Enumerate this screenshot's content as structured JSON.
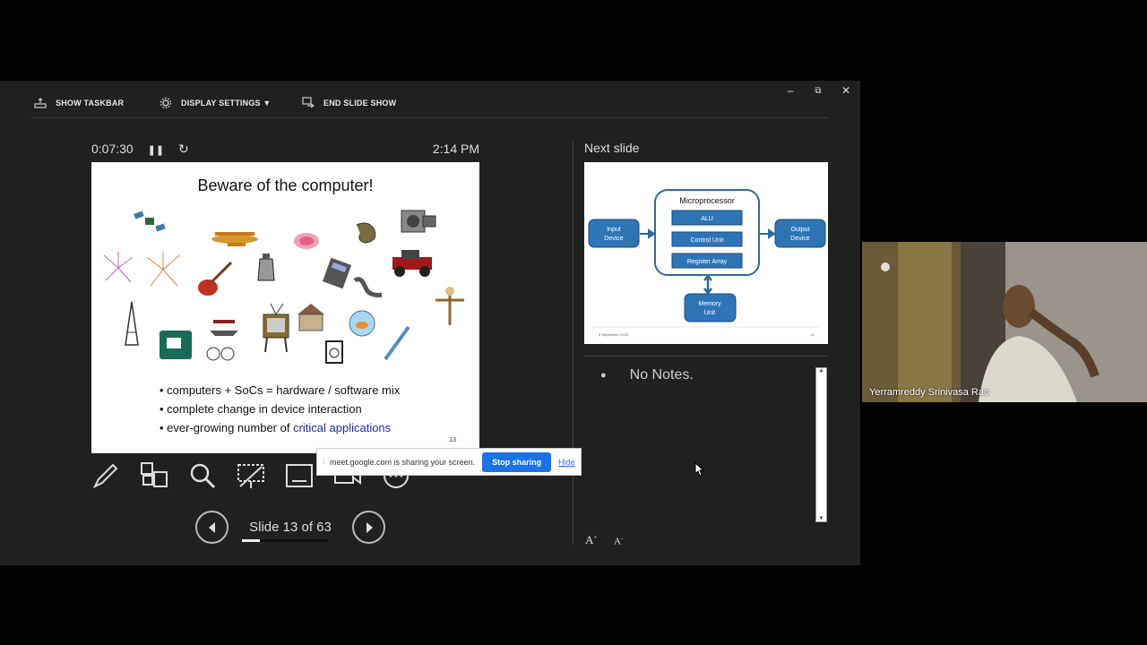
{
  "toolbar": {
    "show_taskbar": "SHOW TASKBAR",
    "display_settings": "DISPLAY SETTINGS ▼",
    "end_slide_show": "END SLIDE SHOW"
  },
  "window_controls": {
    "minimize": "–",
    "restore": "⧉",
    "close": "✕"
  },
  "timer": "0:07:30",
  "clock": "2:14 PM",
  "current_slide": {
    "title": "Beware of the computer!",
    "bullets": [
      "• computers + SoCs = hardware / software mix",
      "• complete change in device interaction"
    ],
    "bullet3_prefix": "• ever-growing number of ",
    "bullet3_highlight": "critical applications",
    "slide_number": "13"
  },
  "navigation": {
    "counter": "Slide 13 of 63",
    "progress_fraction": 0.206
  },
  "next_slide": {
    "label": "Next slide",
    "title": "Microprocessor",
    "alu": "ALU",
    "control_unit": "Control Unit",
    "register_array": "Register Array",
    "input_line1": "Input",
    "input_line2": "Device",
    "output_line1": "Output",
    "output_line2": "Device",
    "memory_line1": "Memory",
    "memory_line2": "Unit",
    "footer_date": "5 September 2023",
    "footer_num": "14"
  },
  "notes": {
    "bullet": "●",
    "text": "No Notes."
  },
  "font_buttons": {
    "increase": "A",
    "decrease": "A"
  },
  "share_bar": {
    "message": "meet.google.com is sharing your screen.",
    "stop": "Stop sharing",
    "hide": "Hide"
  },
  "participant": {
    "name": "Yerramreddy Srinivasa Rao"
  },
  "colors": {
    "accent_blue": "#2e75b6",
    "share_blue": "#1a73e8",
    "background": "#202020"
  }
}
